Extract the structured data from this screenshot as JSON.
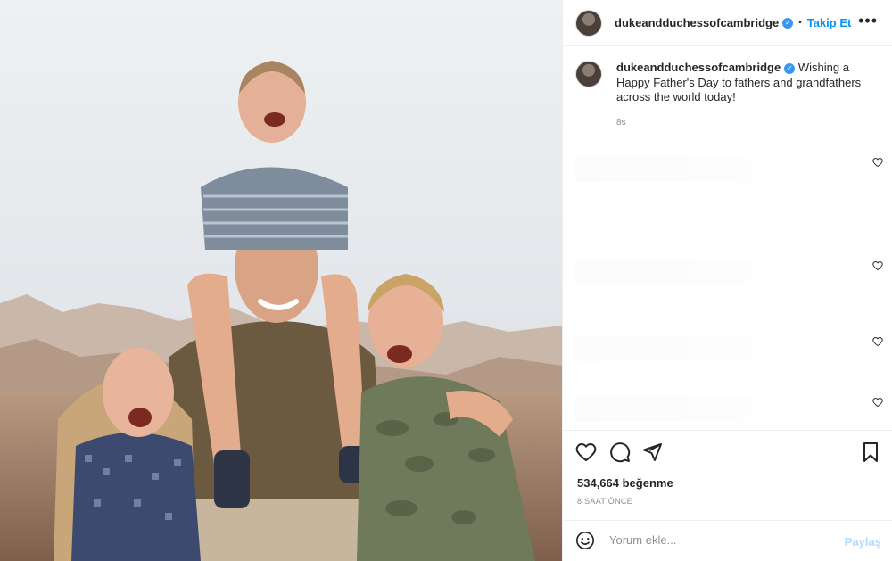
{
  "post": {
    "username": "dukeandduchessofcambridge",
    "follow_label": "Takip Et",
    "dot": "•",
    "more_glyph": "•••",
    "caption_text": "Wishing a Happy Father's Day to fathers and grandfathers across the world today!",
    "caption_time": "8s",
    "likes": "534,664 beğenme",
    "posted_ago": "8 SAAT ÖNCE",
    "comment_placeholder": "Yorum ekle...",
    "share_label": "Paylaş"
  },
  "icons": {
    "verified": "verified-badge-icon",
    "heart": "heart-icon",
    "comment": "comment-icon",
    "share": "send-icon",
    "save": "bookmark-icon",
    "emoji": "emoji-icon"
  },
  "colors": {
    "link": "#0095f6",
    "verified": "#3897f0",
    "muted": "#8e8e8e",
    "text": "#262626"
  }
}
